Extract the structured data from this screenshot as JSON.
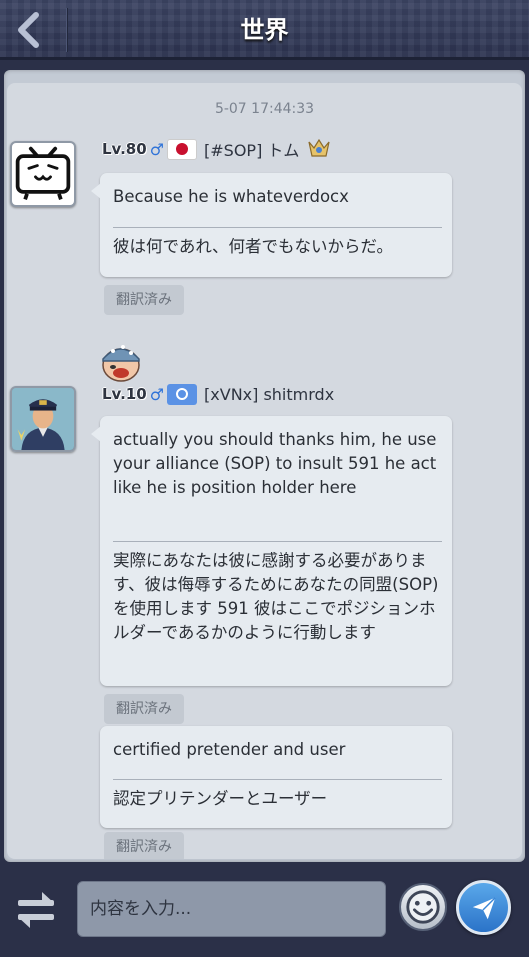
{
  "header": {
    "title": "世界",
    "back_icon": "chevron-left-icon"
  },
  "chat": {
    "timestamp": "5-07 17:44:33",
    "messages": [
      {
        "level": "Lv.80",
        "gender": "♂",
        "flag": "japan-flag-icon",
        "name": "[#SOP] トム",
        "rank_icon": "rank-badge-icon",
        "avatar": "bilibili-tv-avatar",
        "original": "Because he is whateverdocx",
        "translation": "彼は何であれ、何者でもないからだ。",
        "badge": "翻訳済み"
      },
      {
        "level": "Lv.10",
        "gender": "♂",
        "flag": "un-flag-icon",
        "name": "[xVNx] shitmrdx",
        "avatar": "officer-avatar",
        "sticker": "soldier-sticker",
        "original": "actually you should thanks him, he use your alliance (SOP) to insult 591 he act like he is position holder here",
        "translation": "実際にあなたは彼に感謝する必要があります、彼は侮辱するためにあなたの同盟(SOP)を使用します 591 彼はここでポジションホルダーであるかのように行動します",
        "badge": "翻訳済み"
      },
      {
        "original": "certified pretender and user",
        "translation": "認定プリテンダーとユーザー",
        "badge": "翻訳済み"
      }
    ]
  },
  "input": {
    "placeholder": "内容を入力...",
    "switch_icon": "switch-channel-icon",
    "emoji_icon": "smiley-icon",
    "send_icon": "send-icon"
  }
}
